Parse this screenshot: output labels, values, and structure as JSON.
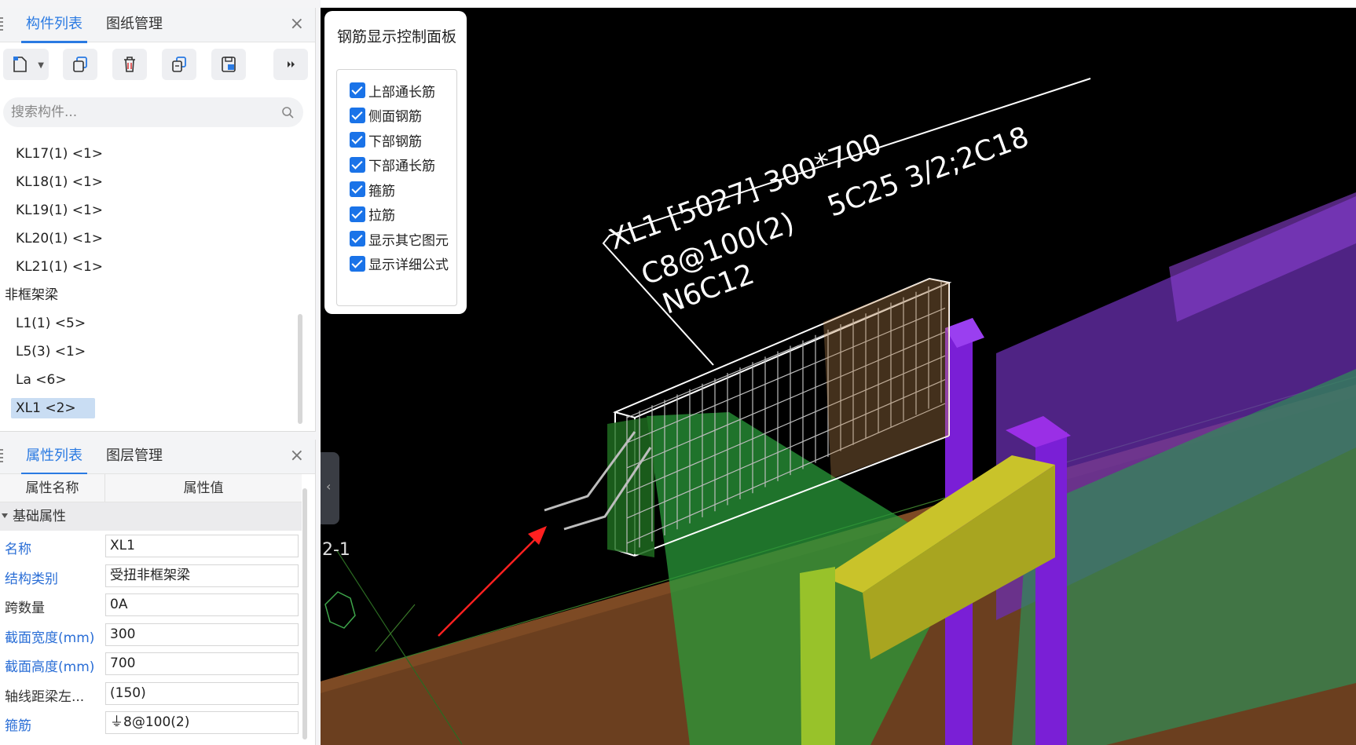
{
  "component_panel": {
    "tabs": [
      "构件列表",
      "图纸管理"
    ],
    "search_placeholder": "搜索构件...",
    "items": [
      {
        "label": "KL17(1) <1>",
        "type": "child"
      },
      {
        "label": "KL18(1) <1>",
        "type": "child"
      },
      {
        "label": "KL19(1) <1>",
        "type": "child"
      },
      {
        "label": "KL20(1) <1>",
        "type": "child"
      },
      {
        "label": "KL21(1) <1>",
        "type": "child"
      },
      {
        "label": "非框架梁",
        "type": "group"
      },
      {
        "label": "L1(1) <5>",
        "type": "child"
      },
      {
        "label": "L5(3) <1>",
        "type": "child"
      },
      {
        "label": "La <6>",
        "type": "child"
      },
      {
        "label": "XL1 <2>",
        "type": "child",
        "selected": true
      }
    ]
  },
  "property_panel": {
    "tabs": [
      "属性列表",
      "图层管理"
    ],
    "col_name": "属性名称",
    "col_value": "属性值",
    "section": "基础属性",
    "rows": [
      {
        "name": "名称",
        "value": "XL1",
        "color": "blue"
      },
      {
        "name": "结构类别",
        "value": "受扭非框架梁",
        "color": "blue"
      },
      {
        "name": "跨数量",
        "value": "0A",
        "color": "dark"
      },
      {
        "name": "截面宽度(mm)",
        "value": "300",
        "color": "blue"
      },
      {
        "name": "截面高度(mm)",
        "value": "700",
        "color": "blue"
      },
      {
        "name": "轴线距梁左...",
        "value": "(150)",
        "color": "dark"
      },
      {
        "name": "箍筋",
        "value": "⏚8@100(2)",
        "color": "blue"
      }
    ]
  },
  "rebar_panel": {
    "title": "钢筋显示控制面板",
    "options": [
      {
        "label": "上部通长筋",
        "checked": true
      },
      {
        "label": "侧面钢筋",
        "checked": true
      },
      {
        "label": "下部钢筋",
        "checked": true
      },
      {
        "label": "下部通长筋",
        "checked": true
      },
      {
        "label": "箍筋",
        "checked": true
      },
      {
        "label": "拉筋",
        "checked": true
      },
      {
        "label": "显示其它图元",
        "checked": true
      },
      {
        "label": "显示详细公式",
        "checked": true
      }
    ]
  },
  "annotation": {
    "line1": "XL1 [5027] 300*700",
    "line1b": "5C25 3/2;2C18",
    "line2": "C8@100(2)",
    "line3": "N6C12"
  },
  "axis_label": "2-1",
  "colors": {
    "accent": "#2a7ae2",
    "viewport_bg": "#000000",
    "slab": "#6b3f1f",
    "purple_column": "#7a1fd6",
    "yellow_beam": "#c9c32a",
    "green_element": "#2aa84a"
  }
}
